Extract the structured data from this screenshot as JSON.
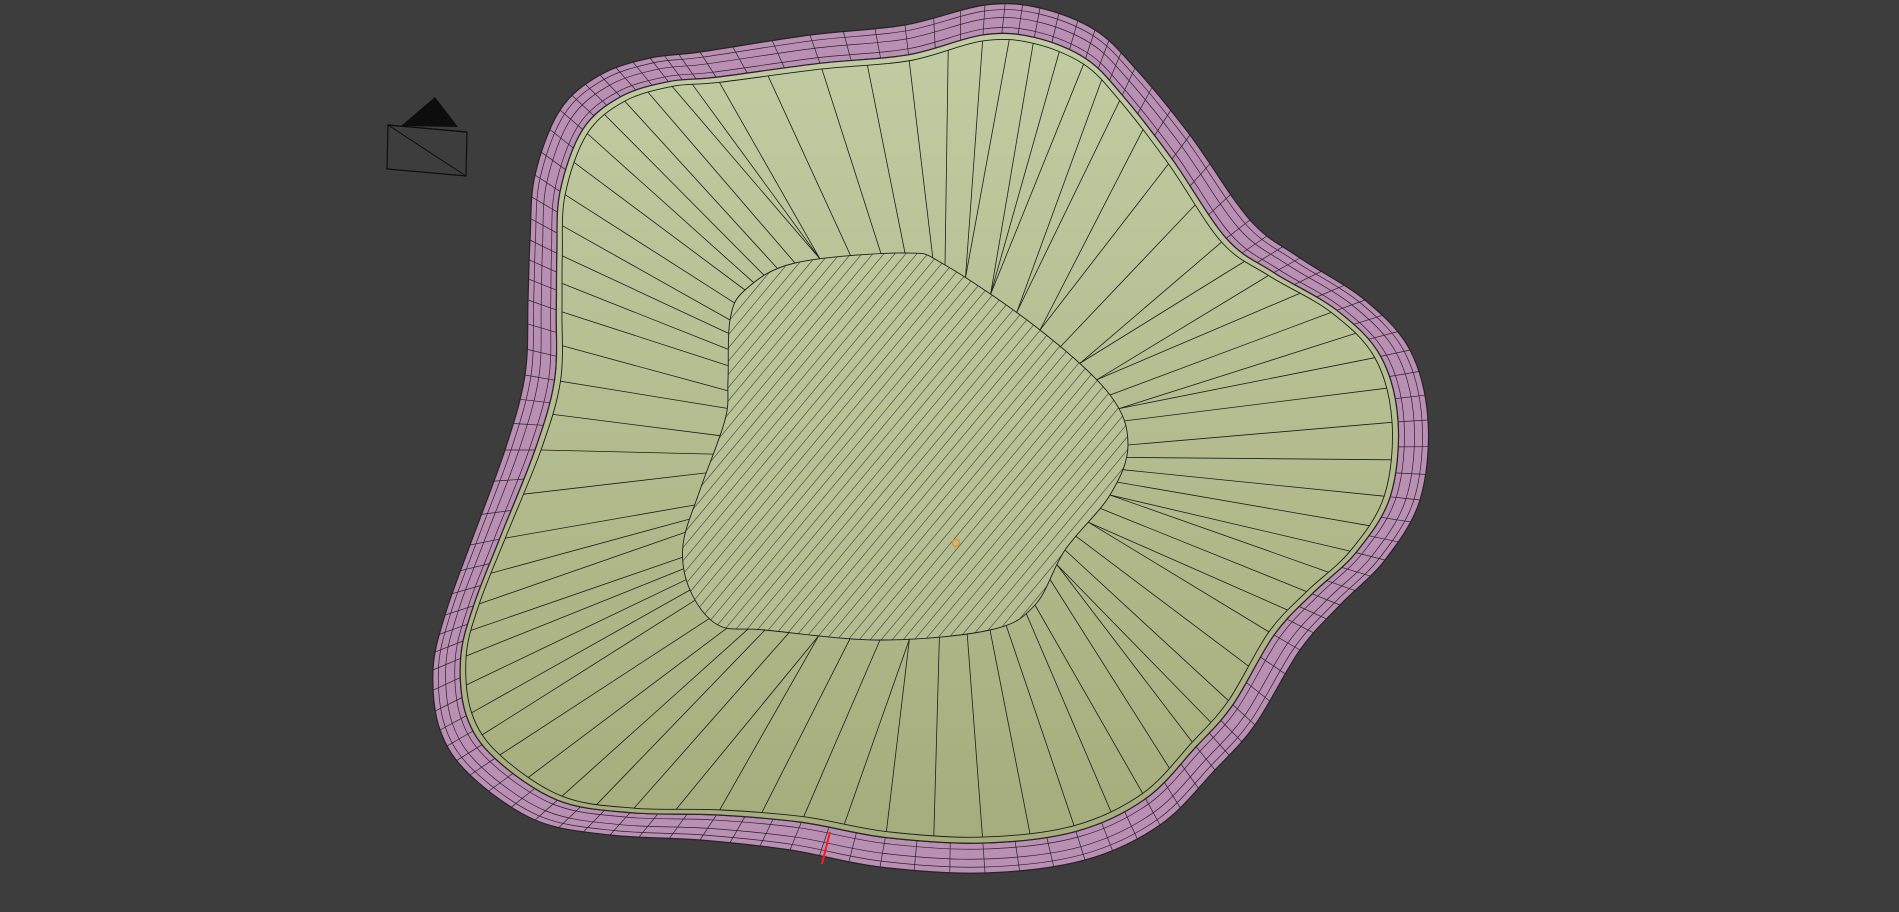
{
  "viewport": {
    "background": "#3d3d3d"
  },
  "scene": {
    "camera_icon": "camera-object-icon",
    "origin_icon": "object-origin-icon",
    "seam_icon": "seam-edge-icon",
    "colors": {
      "rim_fill": "#b98fb3",
      "rim_edge": "#2a2228",
      "face_light": "#c2cca2",
      "face_dark": "#a6ad7c",
      "wire": "#1c1c1c",
      "seam": "#ff1a1a",
      "origin": "#e8902a",
      "camera_line": "#0d0d0d"
    }
  }
}
